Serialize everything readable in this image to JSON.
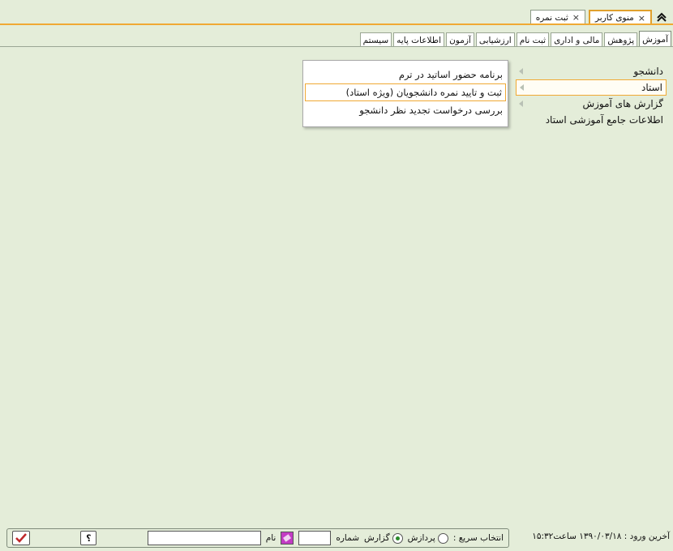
{
  "window_tabs": [
    {
      "label": "منوی کاربر",
      "active": true,
      "close": "×"
    },
    {
      "label": "ثبت نمره",
      "active": false,
      "close": "×"
    }
  ],
  "home_icon": "home-icon",
  "modules": [
    {
      "label": "آموزش",
      "active": true
    },
    {
      "label": "پژوهش"
    },
    {
      "label": "مالی و اداری"
    },
    {
      "label": "ثبت نام"
    },
    {
      "label": "ارزشیابی"
    },
    {
      "label": "آزمون"
    },
    {
      "label": "اطلاعات پایه"
    },
    {
      "label": "سیستم"
    }
  ],
  "nav": [
    {
      "label": "دانشجو",
      "has_children": true
    },
    {
      "label": "استاد",
      "selected": true,
      "has_children": true
    },
    {
      "label": "گزارش های آموزش",
      "has_children": true
    },
    {
      "label": "اطلاعات جامع آموزشی استاد",
      "has_children": false
    }
  ],
  "submenu": [
    {
      "label": "برنامه حضور اساتید در ترم"
    },
    {
      "label": "ثبت و تایید نمره دانشجویان (ویژه استاد)",
      "highlighted": true
    },
    {
      "label": "بررسی درخواست تجدید نظر دانشجو"
    }
  ],
  "status": {
    "last_login": "آخرین ورود : ۱۳۹۰/۰۳/۱۸ ساعت۱۵:۳۲"
  },
  "quick": {
    "label": "انتخاب سریع :",
    "radio_process": "پردازش",
    "radio_report": "گزارش",
    "selected": "report",
    "number_label": "شماره",
    "name_label": "نام",
    "help_glyph": "؟"
  },
  "colors": {
    "background": "#e4edd9",
    "accent_orange": "#f0a934",
    "ok_check": "#c0282b"
  }
}
